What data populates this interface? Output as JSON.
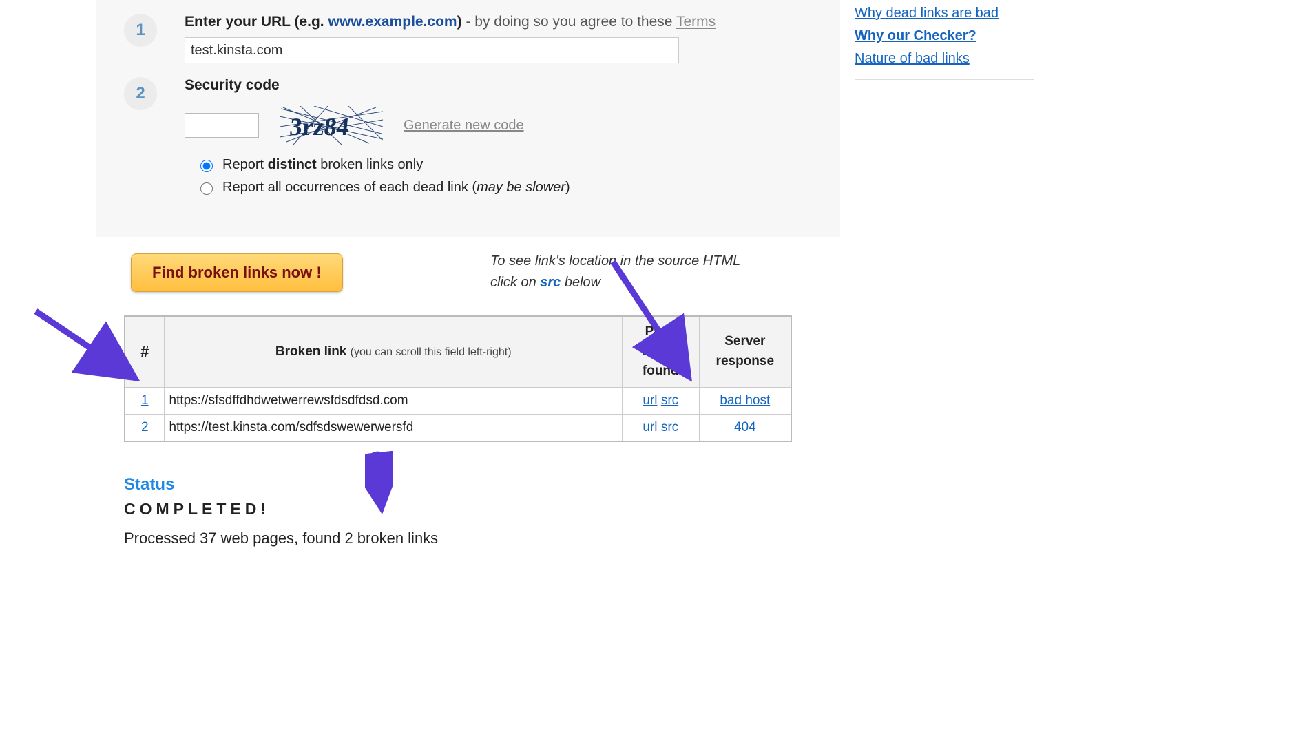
{
  "step1": {
    "label_lead": "Enter your URL (e.g. ",
    "label_example": "www.example.com",
    "label_paren_close": ")",
    "label_tail": " - by doing so you agree to these ",
    "terms": "Terms",
    "url_value": "test.kinsta.com"
  },
  "step2": {
    "label": "Security code",
    "captcha_text": "3rz84",
    "generate": "Generate new code"
  },
  "radios": {
    "opt1_pre": "Report ",
    "opt1_bold": "distinct",
    "opt1_post": " broken links only",
    "opt2_pre": "Report all occurrences of each dead link (",
    "opt2_em": "may be slower",
    "opt2_post": ")"
  },
  "action_button": "Find broken links now !",
  "hint": {
    "line1": "To see link's location in the source HTML",
    "line2_pre": "click on ",
    "line2_src": "src",
    "line2_post": " below"
  },
  "table": {
    "col_num": "#",
    "col_link_main": "Broken link",
    "col_link_sub": "(you can scroll this field left-right)",
    "col_page_l1": "Page",
    "col_page_l2": "where",
    "col_page_l3": "found",
    "col_resp_l1": "Server",
    "col_resp_l2": "response",
    "url_label": "url",
    "src_label": "src",
    "rows": [
      {
        "n": "1",
        "link": "https://sfsdffdhdwetwerrewsfdsdfdsd.com",
        "resp": "bad host"
      },
      {
        "n": "2",
        "link": "https://test.kinsta.com/sdfsdswewerwersfd",
        "resp": "404"
      }
    ]
  },
  "status": {
    "heading": "Status",
    "completed": "COMPLETED!",
    "summary": "Processed 37 web pages, found 2 broken links"
  },
  "sidebar": {
    "link1": "Why dead links are bad",
    "link2": "Why our Checker?",
    "link3": "Nature of bad links"
  }
}
